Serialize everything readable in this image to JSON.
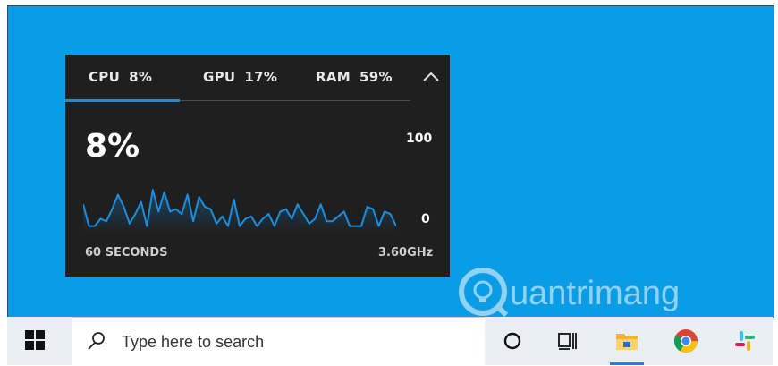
{
  "widget": {
    "tabs": [
      {
        "name": "CPU",
        "value": "8%"
      },
      {
        "name": "GPU",
        "value": "17%"
      },
      {
        "name": "RAM",
        "value": "59%"
      }
    ],
    "big_value": "8%",
    "scale_max": "100",
    "scale_min": "0",
    "footer_left": "60 SECONDS",
    "footer_right": "3.60GHz",
    "accent": "#1a8fe0",
    "collapse_icon": "chevron-up-icon"
  },
  "chart_data": {
    "type": "line",
    "ylim": [
      0,
      100
    ],
    "series": [
      {
        "values": [
          11,
          2,
          2,
          5,
          4,
          9,
          15,
          10,
          3,
          7,
          12,
          2,
          17,
          8,
          16,
          8,
          9,
          7,
          15,
          4,
          14,
          10,
          9,
          3,
          6,
          2,
          13,
          2,
          5,
          6,
          2,
          5,
          7,
          2,
          8,
          9,
          5,
          11,
          7,
          3,
          5,
          11,
          4,
          4,
          6,
          8,
          2,
          2,
          2,
          10,
          9,
          2,
          8,
          7,
          2
        ]
      }
    ]
  },
  "watermark": "uantrimang",
  "taskbar": {
    "search_placeholder": "Type here to search",
    "icons": [
      "windows-start-icon",
      "cortana-icon",
      "task-view-icon",
      "file-explorer-icon",
      "chrome-icon",
      "slack-icon"
    ]
  }
}
